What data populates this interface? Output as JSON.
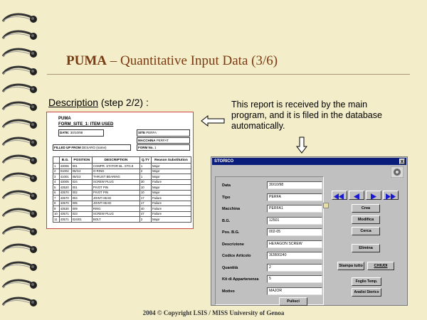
{
  "slide": {
    "title_bold": "PUMA",
    "title_rest": " – Quantitative Input Data (3/6)",
    "desc_link": "Description",
    "desc_rest": " (step 2/2) :",
    "note": "This report is received by the main program, and it is filed in the database automatically.",
    "footer": "2004 © Copyright LSIS / MISS University of Genoa"
  },
  "report": {
    "title1": "PUMA",
    "title2": "FORM_SITE_1: ITEM USED",
    "date_label": "DATE:",
    "date_value": "30/10/98",
    "site_label": "SITE",
    "site_value": "PERFA",
    "macchina_label": "MACCHINA",
    "macchina_value": "PERFAT",
    "form_label": "FORM No.",
    "form_value": "1",
    "filled_label": "FILLED UP FROM",
    "filled_value": "DESARO",
    "name_label": "(name)",
    "headers": [
      "",
      "B.G.",
      "POSITION",
      "DESCRIPTION",
      "Q.TY",
      "Reason Substitution"
    ],
    "rows": [
      [
        "1",
        "43006",
        "001",
        "COMPR. STATOR BL. STG.8",
        "1",
        "Major"
      ],
      [
        "2",
        "01002",
        "05/G4",
        "O-RING",
        "2",
        "Major"
      ],
      [
        "3",
        "41001",
        "05/G3",
        "THRUST BEARING",
        "1",
        "Major"
      ],
      [
        "4",
        "43005",
        "024",
        "SCREW PLUG",
        "30",
        "Failure"
      ],
      [
        "5",
        "43520",
        "001",
        "PIVOT PIN",
        "10",
        "Major"
      ],
      [
        "6",
        "43570",
        "002",
        "PIVOT PIN",
        "10",
        "Major"
      ],
      [
        "7",
        "43570",
        "004",
        "JOINT HEAD",
        "17",
        "Failure"
      ],
      [
        "8",
        "43570",
        "005",
        "JOINT HEAD",
        "17",
        "Failure"
      ],
      [
        "9",
        "43530",
        "009",
        "RING",
        "40",
        "Failure"
      ],
      [
        "10",
        "43571",
        "023",
        "SCREW PLUG",
        "47",
        "Failure"
      ],
      [
        "11",
        "43571",
        "024/01",
        "BOLT",
        "2",
        "Major"
      ]
    ]
  },
  "dialog": {
    "title": "STORICO",
    "close": "x",
    "fields": [
      {
        "label": "Data",
        "value": "30/10/98"
      },
      {
        "label": "Tipo",
        "value": "PERFA"
      },
      {
        "label": "Macchina",
        "value": "PERFA1"
      },
      {
        "label": "B.G.",
        "value": "12501"
      },
      {
        "label": "Pos. B.G.",
        "value": "002-05"
      },
      {
        "label": "Descrizione",
        "value": "HEXAGON SCREW"
      },
      {
        "label": "Codice Articolo",
        "value": "3I2800240"
      },
      {
        "label": "Quantità",
        "value": "2"
      },
      {
        "label": "Kit di Appartenenza",
        "value": "5"
      },
      {
        "label": "Motivo",
        "value": "MAJOR"
      }
    ],
    "pulisci": "Pulisci",
    "crea": "Crea",
    "modifica": "Modifica",
    "cerca": "Cerca",
    "elimina": "Elimina",
    "stampa": "Stampa tutto",
    "chiudi": "CHIUDI",
    "foglio": "Foglio Temp.",
    "analisi": "Analisi Storico",
    "nav_color": "#1a1ad0"
  }
}
